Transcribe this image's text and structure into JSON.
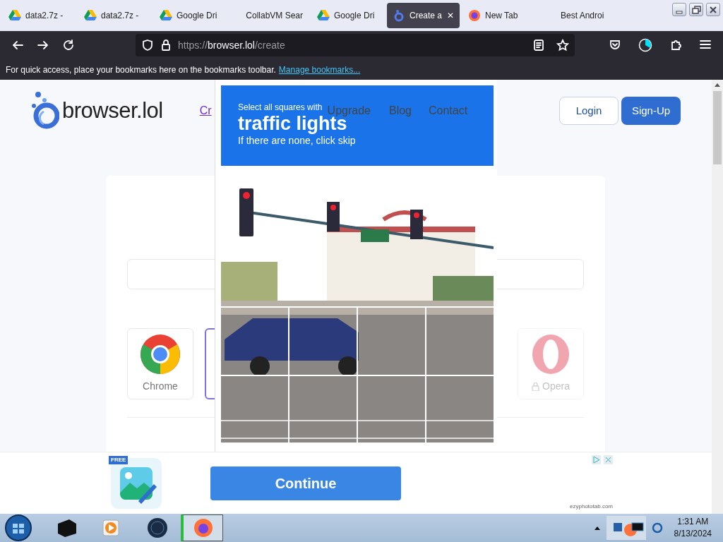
{
  "browser_tabs": [
    {
      "title": "data2.7z -",
      "kind": "drive",
      "selected": false
    },
    {
      "title": "data2.7z -",
      "kind": "drive",
      "selected": false
    },
    {
      "title": "Google Dri",
      "kind": "drive",
      "selected": false
    },
    {
      "title": "CollabVM Sear",
      "kind": "plain",
      "selected": false
    },
    {
      "title": "Google Dri",
      "kind": "drive",
      "selected": false
    },
    {
      "title": "Create a",
      "kind": "site",
      "selected": true
    },
    {
      "title": "New Tab",
      "kind": "firefox",
      "selected": false
    },
    {
      "title": "Best Androi",
      "kind": "plain",
      "selected": false
    }
  ],
  "close_tab": "✕",
  "address_bar": {
    "scheme": "https://",
    "host": "browser.lol",
    "path": "/create"
  },
  "bookmarks_bar": {
    "text": "For quick access, place your bookmarks here on the bookmarks toolbar.",
    "link": "Manage bookmarks..."
  },
  "site": {
    "logo": "browser.lol",
    "nav": [
      {
        "label": "Cr",
        "visited": true
      },
      {
        "label": "Upgrade",
        "visited": false
      },
      {
        "label": "Blog",
        "visited": false
      },
      {
        "label": "Contact",
        "visited": false
      }
    ],
    "login": "Login",
    "signup": "Sign-Up",
    "browsers": [
      {
        "label": "Chrome",
        "kind": "chrome",
        "selected": false,
        "locked": false
      },
      {
        "kind": "blank",
        "selected": true,
        "locked": false
      },
      {
        "label": "Opera",
        "kind": "opera",
        "selected": false,
        "locked": true
      }
    ]
  },
  "captcha": {
    "instruction": "Select all squares with",
    "target": "traffic lights",
    "hint": "If there are none, click skip"
  },
  "ad": {
    "badge": "FREE",
    "button": "Continue",
    "domain": "ezyphototab.com"
  },
  "taskbar": {
    "time": "1:31 AM",
    "date": "8/13/2024"
  }
}
